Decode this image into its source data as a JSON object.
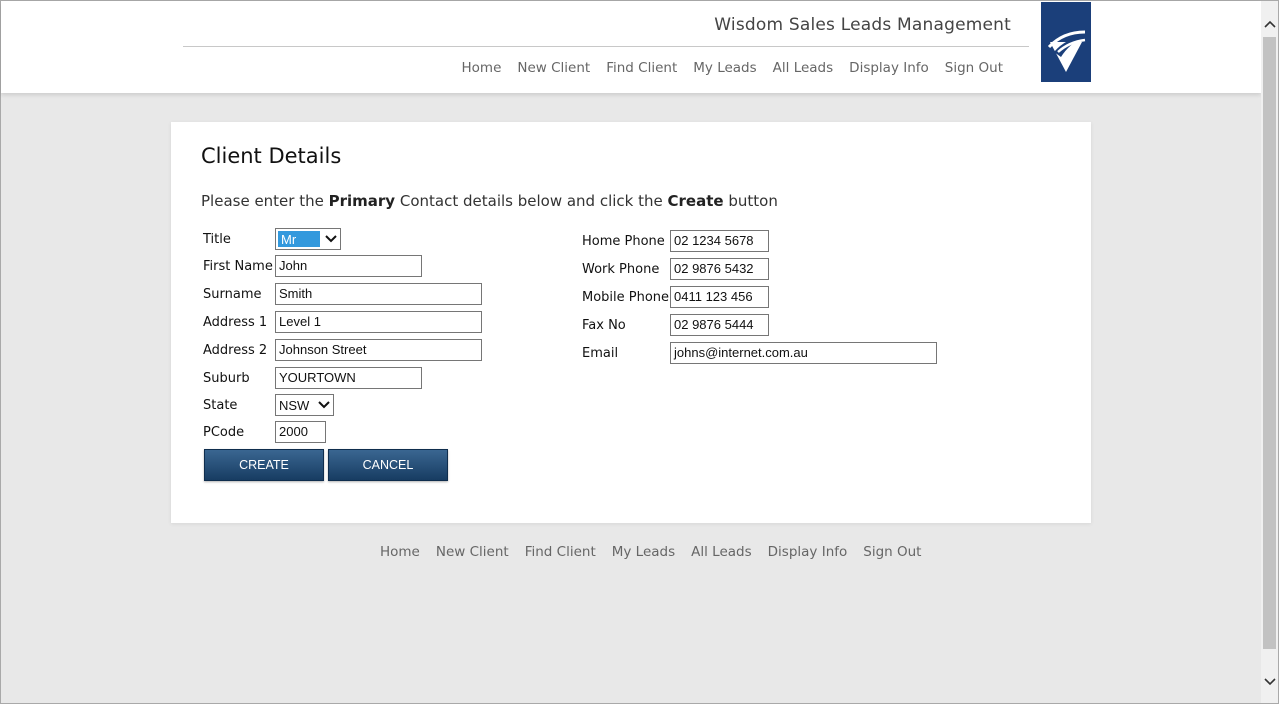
{
  "header": {
    "app_title": "Wisdom Sales Leads Management",
    "nav": [
      "Home",
      "New Client",
      "Find Client",
      "My Leads",
      "All Leads",
      "Display Info",
      "Sign Out"
    ]
  },
  "form": {
    "title": "Client Details",
    "instructions": {
      "part1": "Please enter the ",
      "bold1": "Primary",
      "part2": " Contact details below and click the ",
      "bold2": "Create",
      "part3": " button"
    },
    "fields": {
      "title": {
        "label": "Title",
        "value": "Mr"
      },
      "first_name": {
        "label": "First Name",
        "value": "John"
      },
      "surname": {
        "label": "Surname",
        "value": "Smith"
      },
      "address1": {
        "label": "Address 1",
        "value": "Level 1"
      },
      "address2": {
        "label": "Address 2",
        "value": "Johnson Street"
      },
      "suburb": {
        "label": "Suburb",
        "value": "YOURTOWN"
      },
      "state": {
        "label": "State",
        "value": "NSW"
      },
      "pcode": {
        "label": "PCode",
        "value": "2000"
      },
      "home_phone": {
        "label": "Home Phone",
        "value": "02 1234 5678"
      },
      "work_phone": {
        "label": "Work Phone",
        "value": "02 9876 5432"
      },
      "mobile_phone": {
        "label": "Mobile Phone",
        "value": "0411 123 456"
      },
      "fax": {
        "label": "Fax No",
        "value": "02 9876 5444"
      },
      "email": {
        "label": "Email",
        "value": "johns@internet.com.au"
      }
    },
    "buttons": {
      "create": "CREATE",
      "cancel": "CANCEL"
    }
  },
  "footer": {
    "nav": [
      "Home",
      "New Client",
      "Find Client",
      "My Leads",
      "All Leads",
      "Display Info",
      "Sign Out"
    ]
  },
  "colors": {
    "brand": "#1b3f7a",
    "button": "#1f4a73",
    "page_bg": "#e8e8e8",
    "select_highlight": "#3399dd"
  }
}
